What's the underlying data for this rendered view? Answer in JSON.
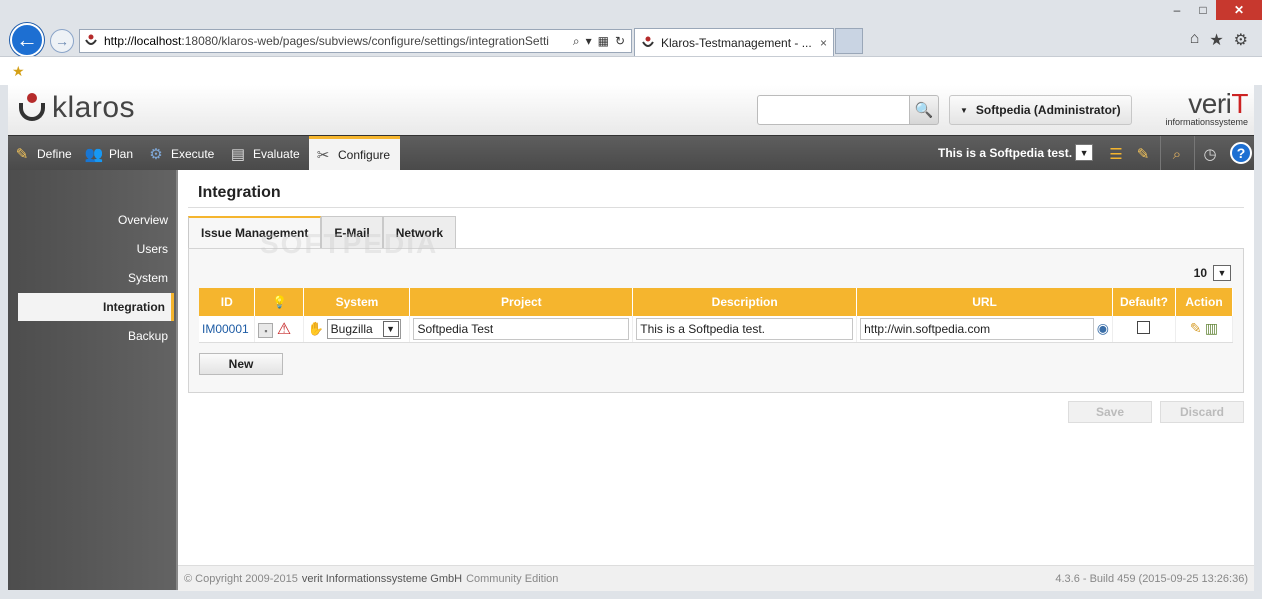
{
  "browser": {
    "url_host": "http://localhost",
    "url_path": ":18080/klaros-web/pages/subviews/configure/settings/integrationSetti",
    "tab_title": "Klaros-Testmanagement - ...",
    "tab_close": "×",
    "win_minimize": "–",
    "win_maximize": "□",
    "win_close": "✕"
  },
  "header": {
    "logo_text": "klaros",
    "search_placeholder": "",
    "user_label": "Softpedia (Administrator)",
    "brand_top": "veri",
    "brand_accent": "T",
    "brand_bottom": "informationssysteme"
  },
  "toolbar": {
    "items": [
      {
        "label": "Define",
        "icon": "define-icon"
      },
      {
        "label": "Plan",
        "icon": "plan-icon"
      },
      {
        "label": "Execute",
        "icon": "execute-icon"
      },
      {
        "label": "Evaluate",
        "icon": "evaluate-icon"
      },
      {
        "label": "Configure",
        "icon": "configure-icon"
      }
    ],
    "active": "Configure",
    "project": "This is a Softpedia test.",
    "help": "?"
  },
  "sidebar": {
    "items": [
      {
        "label": "Overview"
      },
      {
        "label": "Users"
      },
      {
        "label": "System"
      },
      {
        "label": "Integration"
      },
      {
        "label": "Backup"
      }
    ],
    "active": "Integration"
  },
  "main": {
    "title": "Integration",
    "tabs": [
      {
        "label": "Issue Management"
      },
      {
        "label": "E-Mail"
      },
      {
        "label": "Network"
      }
    ],
    "active_tab": "Issue Management",
    "page_size": "10",
    "table": {
      "columns": [
        "ID",
        "",
        "System",
        "Project",
        "Description",
        "URL",
        "Default?",
        "Action"
      ],
      "rows": [
        {
          "id": "IM00001",
          "system": "Bugzilla",
          "project": "Softpedia Test",
          "description": "This is a Softpedia test.",
          "url": "http://win.softpedia.com",
          "default": false
        }
      ]
    },
    "new_label": "New",
    "save_label": "Save",
    "discard_label": "Discard",
    "watermark": "SOFTPEDIA"
  },
  "footer": {
    "copyright": "© Copyright 2009-2015",
    "company": "verit Informationssysteme GmbH",
    "edition": "Community Edition",
    "version": "4.3.6 - Build 459 (2015-09-25 13:26:36)"
  },
  "colors": {
    "accent": "#f5b52e",
    "toolbar_bg": "#4a4a4a",
    "link": "#1e5ca5",
    "brand_red": "#b52b2b"
  }
}
